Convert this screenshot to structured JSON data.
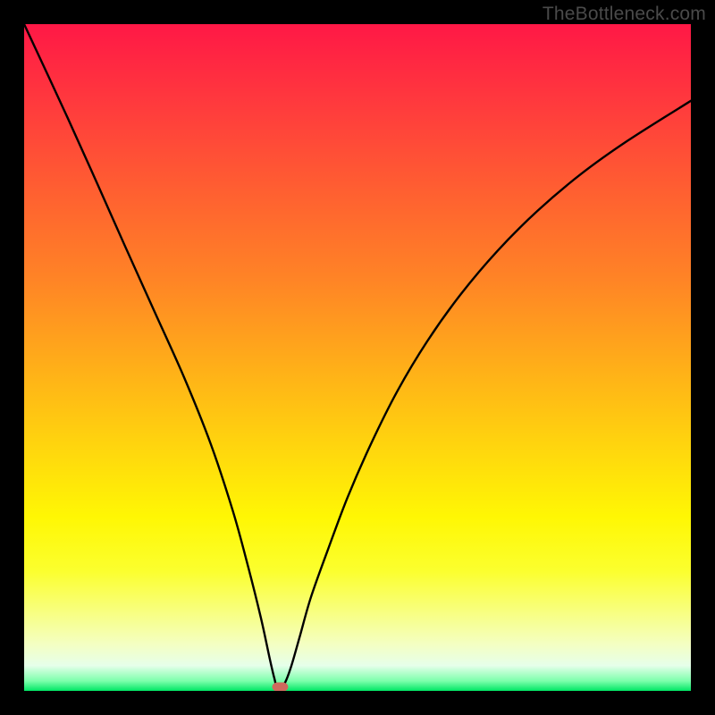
{
  "watermark": "TheBottleneck.com",
  "chart_data": {
    "type": "line",
    "title": "",
    "xlabel": "",
    "ylabel": "",
    "xlim": [
      0,
      100
    ],
    "ylim": [
      0,
      100
    ],
    "series": [
      {
        "name": "bottleneck-curve",
        "x": [
          0,
          6.5,
          11,
          15,
          19.5,
          24,
          28,
          31.3,
          33.5,
          35.5,
          36.8,
          37.5,
          38,
          39,
          40,
          41.3,
          43,
          45.5,
          48.5,
          52,
          56,
          60.5,
          65.5,
          71,
          77,
          83.5,
          90.5,
          100
        ],
        "values": [
          100,
          86,
          76,
          67,
          57,
          47,
          37,
          27,
          19,
          11,
          5,
          2,
          0.5,
          1,
          3.5,
          8,
          14,
          21,
          29,
          37,
          45,
          52.5,
          59.5,
          66,
          72,
          77.5,
          82.5,
          88.5
        ]
      }
    ],
    "annotations": [
      {
        "name": "minimum-marker",
        "x": 38.4,
        "y": 0.6,
        "width_pct": 2.4,
        "height_pct": 1.35,
        "color": "#cf6a5d"
      }
    ],
    "gradient_stops": [
      {
        "offset": 0.0,
        "color": "#ff1846"
      },
      {
        "offset": 0.12,
        "color": "#ff3a3d"
      },
      {
        "offset": 0.25,
        "color": "#ff5f31"
      },
      {
        "offset": 0.38,
        "color": "#ff8326"
      },
      {
        "offset": 0.5,
        "color": "#ffaa1a"
      },
      {
        "offset": 0.62,
        "color": "#ffd10f"
      },
      {
        "offset": 0.74,
        "color": "#fff704"
      },
      {
        "offset": 0.82,
        "color": "#fbff2e"
      },
      {
        "offset": 0.88,
        "color": "#f8ff7e"
      },
      {
        "offset": 0.93,
        "color": "#f4ffc2"
      },
      {
        "offset": 0.962,
        "color": "#e6ffea"
      },
      {
        "offset": 0.985,
        "color": "#7dffac"
      },
      {
        "offset": 1.0,
        "color": "#00e765"
      }
    ]
  }
}
